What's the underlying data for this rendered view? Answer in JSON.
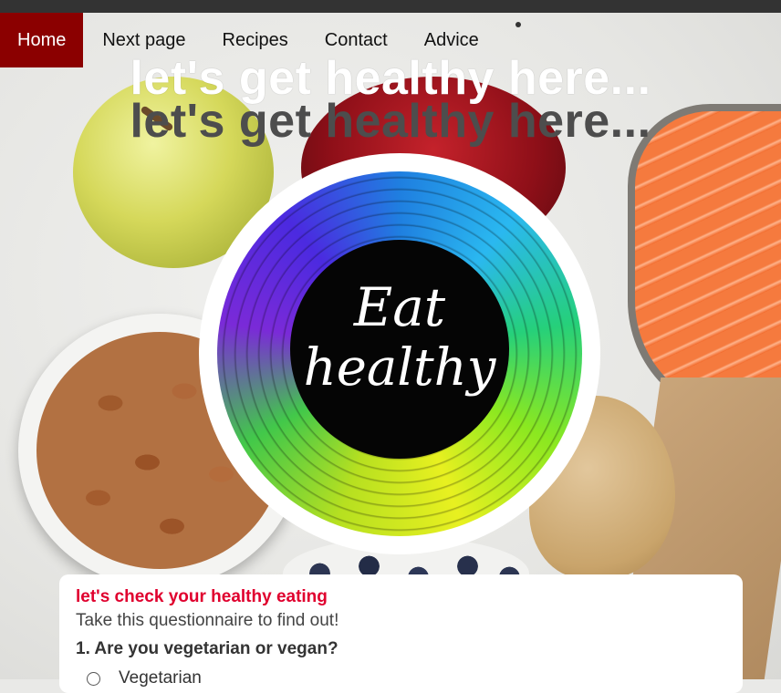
{
  "nav": {
    "items": [
      {
        "label": "Home",
        "active": true
      },
      {
        "label": "Next page",
        "active": false
      },
      {
        "label": "Recipes",
        "active": false
      },
      {
        "label": "Contact",
        "active": false
      },
      {
        "label": "Advice",
        "active": false
      }
    ]
  },
  "hero": {
    "headline": "let's get healthy here...",
    "badge_line1": "Eat",
    "badge_line2": "healthy"
  },
  "questionnaire": {
    "title": "let's check your healthy eating",
    "subtitle": "Take this questionnaire to find out!",
    "question": "1. Are you vegetarian or vegan?",
    "option1": "Vegetarian"
  },
  "colors": {
    "nav_active_bg": "#8b0000",
    "title_red": "#e0002e",
    "topbar": "#333333"
  }
}
